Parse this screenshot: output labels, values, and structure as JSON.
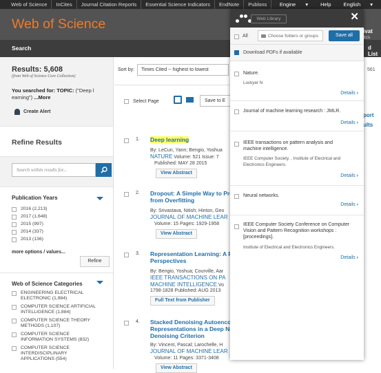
{
  "topnav": {
    "links": [
      "Web of Science",
      "InCites",
      "Journal Citation Reports",
      "Essential Science Indicators",
      "EndNote",
      "Publons"
    ],
    "right": {
      "engine": "Engine",
      "help": "Help",
      "english": "English"
    }
  },
  "header": {
    "brand": "Web of Science",
    "right_partial_1": "rivat",
    "right_partial_2": "ytics"
  },
  "subbar": {
    "search": "Search",
    "right_partial": "d List"
  },
  "results": {
    "count": "Results: 5,608",
    "source": "(from Web of Science Core Collection)",
    "searched_prefix": "You searched for: TOPIC:",
    "searched_query": "(\"Deep l earning\")",
    "more": "...More",
    "create_alert": "Create Alert"
  },
  "refine": {
    "title": "Refine Results",
    "search_placeholder": "Search within results for...",
    "pub_years_title": "Publication Years",
    "years": [
      "2016 (2,213)",
      "2017 (1,648)",
      "2015 (997)",
      "2014 (337)",
      "2013 (136)"
    ],
    "more_options": "more options / values...",
    "refine_button": "Refine",
    "categories_title": "Web of Science Categories",
    "categories": [
      "ENGINEERING ELECTRICAL ELECTRONIC (1,984)",
      "COMPUTER SCIENCE ARTIFICIAL INTELLIGENCE (1,884)",
      "COMPUTER SCIENCE THEORY METHODS (1,107)",
      "COMPUTER SCIENCE INFORMATION SYSTEMS (832)",
      "COMPUTER SCIENCE INTERDISCIPLINARY APPLICATIONS (554)"
    ]
  },
  "toolbar": {
    "sort_by": "Sort by:",
    "sort_value": "Times Cited -- highest to lowest",
    "select_page": "Select Page",
    "save_to": "Save to E",
    "page_count_partial": "561",
    "right_partial_1": "port",
    "right_partial_2": "ults"
  },
  "records": [
    {
      "num": "1.",
      "title": "Deep learning",
      "authors": "By: LeCun, Yann; Bengio, Yoshua",
      "journal": "NATURE",
      "meta": "Volume: 521  Issue: 7",
      "published": "Published: MAY 28 2015",
      "action": "View Abstract"
    },
    {
      "num": "2.",
      "title": "Dropout: A Simple Way to Pre from Overfitting",
      "authors": "By: Srivastava, Nitish; Hinton, Geo",
      "journal": "JOURNAL OF MACHINE LEAR",
      "meta": "Volume: 15  Pages: 1929-1958",
      "published": "",
      "action": "View Abstract"
    },
    {
      "num": "3.",
      "title": "Representation Learning: A R Perspectives",
      "authors": "By: Bengio, Yoshua; Courville, Aar",
      "journal": "IEEE TRANSACTIONS ON PA MACHINE INTELLIGENCE",
      "meta": "Vo",
      "published": "1798-1828  Published: AUG 2013",
      "action": "Full Text from Publisher"
    },
    {
      "num": "4.",
      "title": "Stacked Denoising Autoenco Representations in a Deep Ne Denoising Criterion",
      "authors": "By: Vincent, Pascal; Larochelle, H",
      "journal": "JOURNAL OF MACHINE LEAR",
      "meta": "Volume: 11  Pages: 3371-3408",
      "published": "",
      "action": "View Abstract"
    }
  ],
  "panel": {
    "library_button": "Web Library",
    "close": "✕",
    "all_label": "All",
    "folder_placeholder": "Choose folders or groups",
    "save_all": "Save all",
    "download_label": "Download PDFs if available",
    "details": "Details",
    "items": [
      {
        "title": "Nature.",
        "sub": "Lockyer N"
      },
      {
        "title": "Journal of machine learning research : JMLR.",
        "sub": ""
      },
      {
        "title": "IEEE transactions on pattern analysis and machine intelligence.",
        "sub": "IEEE Computer Society. , Institute of Electrical and Electronics Engineers."
      },
      {
        "title": "Neural networks.",
        "sub": ""
      },
      {
        "title": "IEEE Computer Society Conference on Computer Vision and Pattern Recognition workshops : [proceedings].",
        "sub": "Institute of Electrical and Electronics Engineers."
      }
    ]
  },
  "colors": {
    "accent": "#f07b26",
    "link": "#1f6ea8",
    "highlight": "#ffff66"
  }
}
